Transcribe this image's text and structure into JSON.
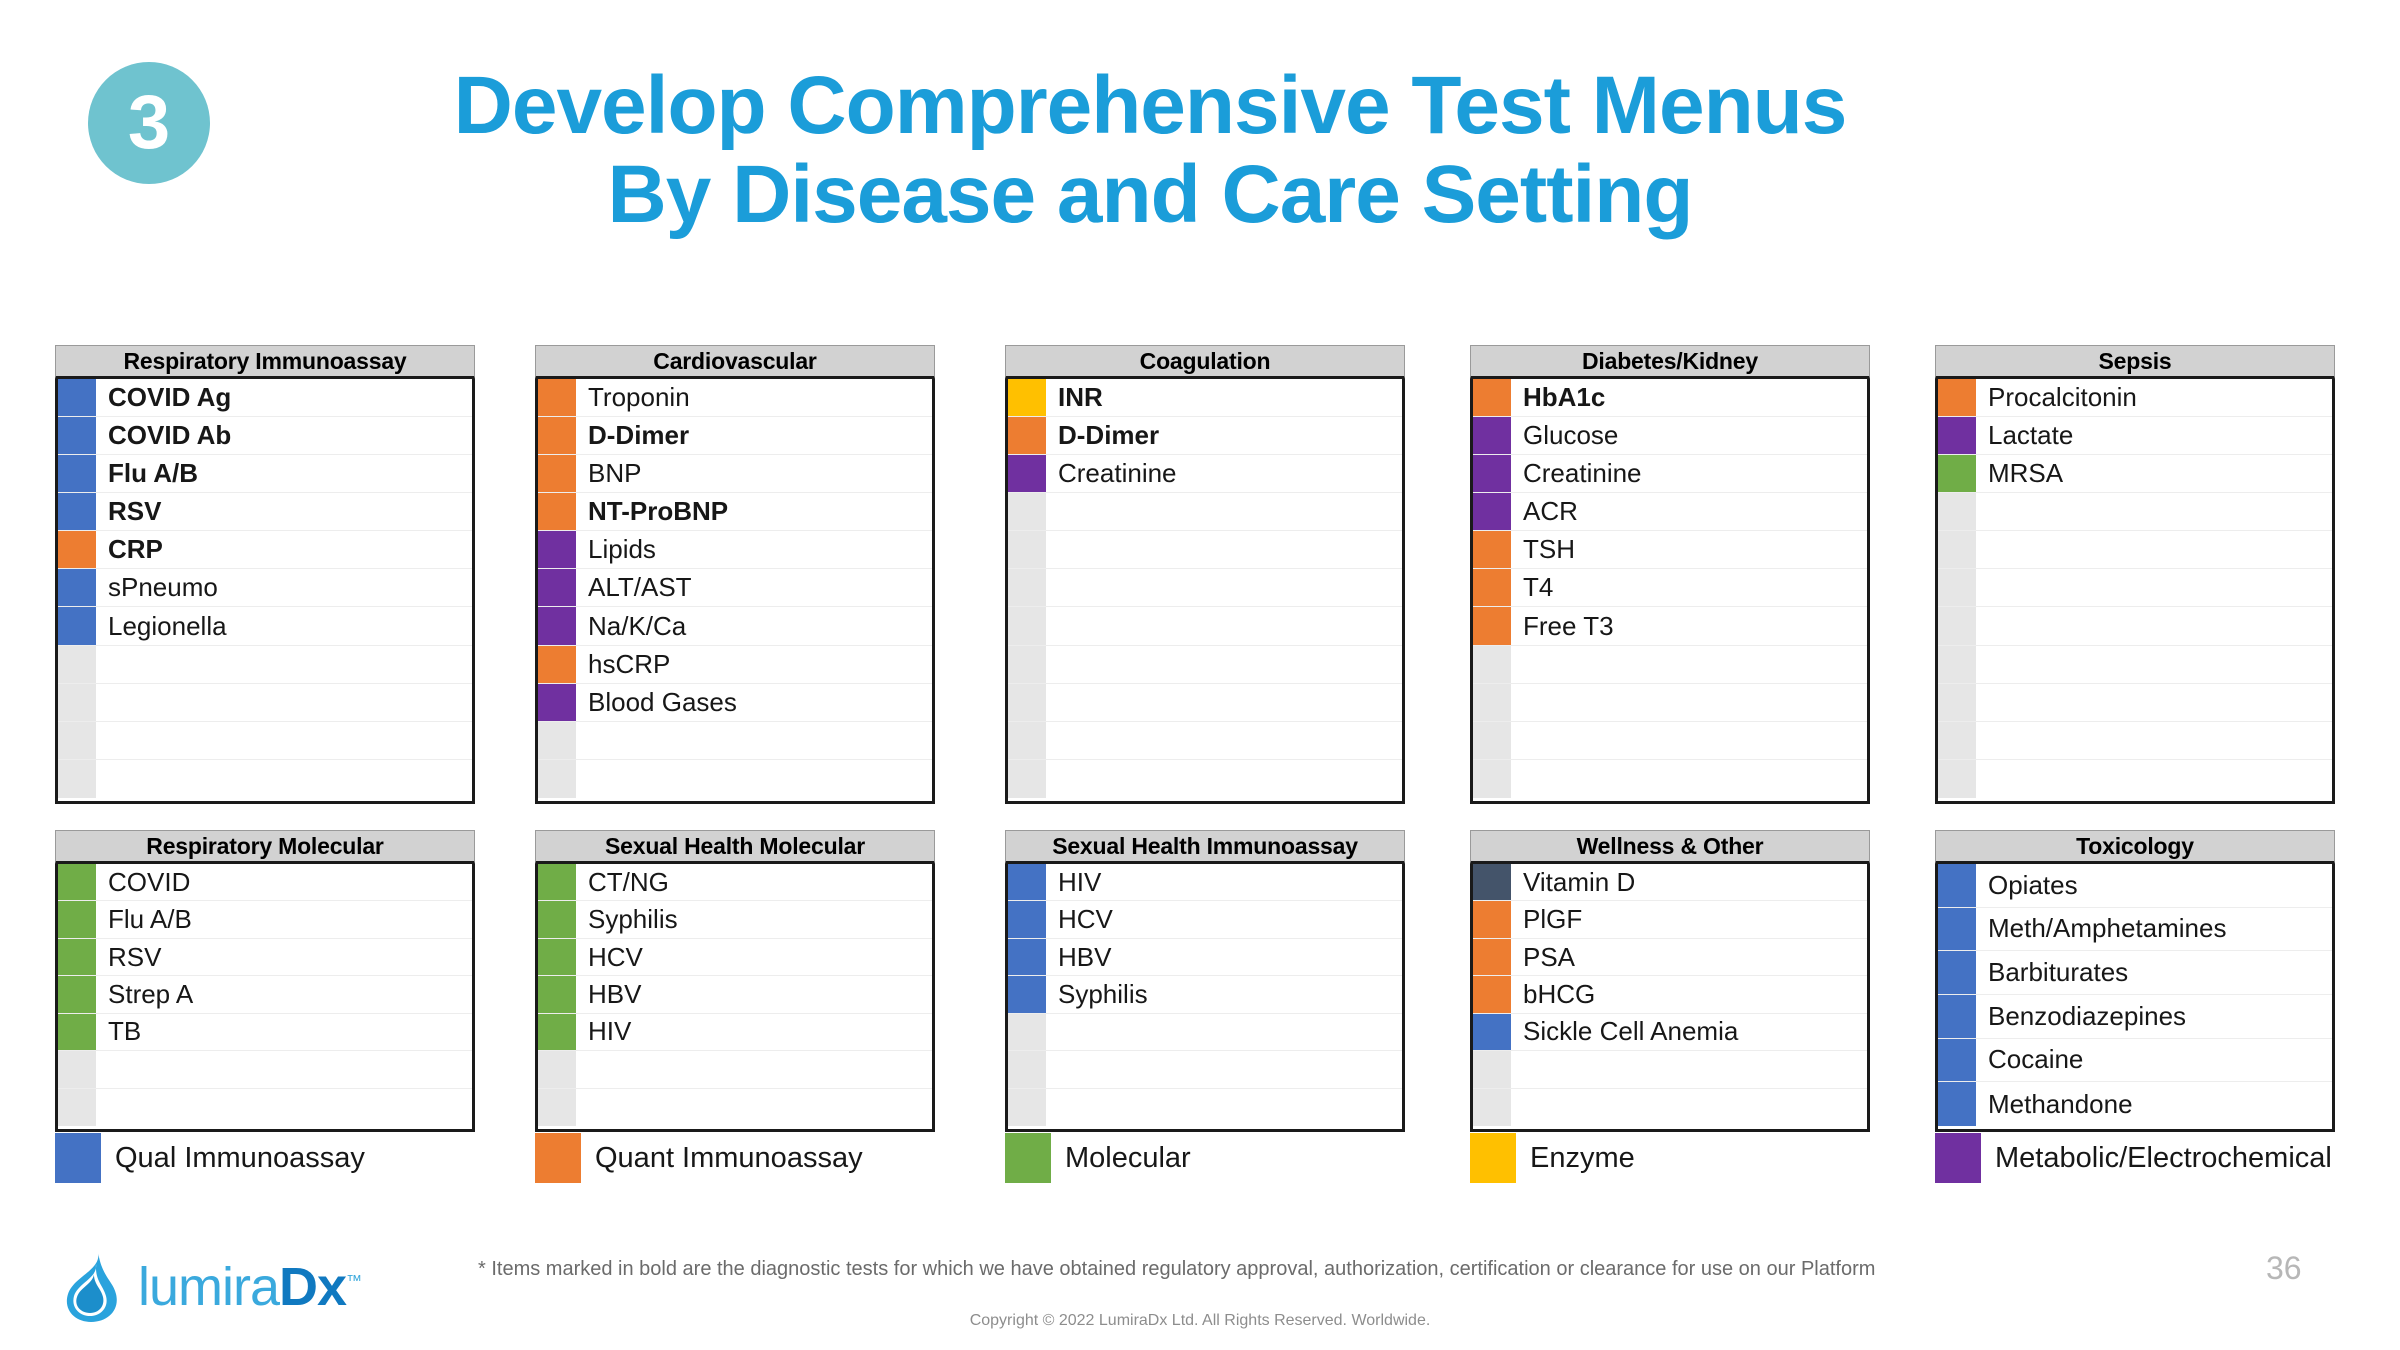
{
  "header": {
    "step_number": "3",
    "title_line1": "Develop Comprehensive Test Menus",
    "title_line2": "By Disease and Care Setting",
    "title_color": "#1b9dd9",
    "badge_color": "#6fc3cf"
  },
  "colors": {
    "qual_immunoassay": "#4472c4",
    "quant_immunoassay": "#ed7d31",
    "molecular": "#70ad47",
    "enzyme": "#ffc000",
    "metabolic_electrochemical": "#7030a0",
    "vitamin_d_dark": "#44546a",
    "empty_row": "#e6e6e6",
    "header_fill": "#d2d2d2"
  },
  "tables": [
    {
      "title": "Respiratory Immunoassay",
      "rows": [
        {
          "label": "COVID Ag",
          "color": "#4472c4",
          "bold": true
        },
        {
          "label": "COVID Ab",
          "color": "#4472c4",
          "bold": true
        },
        {
          "label": "Flu A/B",
          "color": "#4472c4",
          "bold": true
        },
        {
          "label": "RSV",
          "color": "#4472c4",
          "bold": true
        },
        {
          "label": "CRP",
          "color": "#ed7d31",
          "bold": true
        },
        {
          "label": "sPneumo",
          "color": "#4472c4",
          "bold": false
        },
        {
          "label": "Legionella",
          "color": "#4472c4",
          "bold": false
        },
        {
          "label": "",
          "color": "#e6e6e6",
          "bold": false
        },
        {
          "label": "",
          "color": "#e6e6e6",
          "bold": false
        },
        {
          "label": "",
          "color": "#e6e6e6",
          "bold": false
        },
        {
          "label": "",
          "color": "#e6e6e6",
          "bold": false
        }
      ]
    },
    {
      "title": "Cardiovascular",
      "rows": [
        {
          "label": "Troponin",
          "color": "#ed7d31",
          "bold": false
        },
        {
          "label": "D-Dimer",
          "color": "#ed7d31",
          "bold": true
        },
        {
          "label": "BNP",
          "color": "#ed7d31",
          "bold": false
        },
        {
          "label": "NT-ProBNP",
          "color": "#ed7d31",
          "bold": true
        },
        {
          "label": "Lipids",
          "color": "#7030a0",
          "bold": false
        },
        {
          "label": "ALT/AST",
          "color": "#7030a0",
          "bold": false
        },
        {
          "label": "Na/K/Ca",
          "color": "#7030a0",
          "bold": false
        },
        {
          "label": "hsCRP",
          "color": "#ed7d31",
          "bold": false
        },
        {
          "label": "Blood Gases",
          "color": "#7030a0",
          "bold": false
        },
        {
          "label": "",
          "color": "#e6e6e6",
          "bold": false
        },
        {
          "label": "",
          "color": "#e6e6e6",
          "bold": false
        }
      ]
    },
    {
      "title": "Coagulation",
      "rows": [
        {
          "label": "INR",
          "color": "#ffc000",
          "bold": true
        },
        {
          "label": "D-Dimer",
          "color": "#ed7d31",
          "bold": true
        },
        {
          "label": "Creatinine",
          "color": "#7030a0",
          "bold": false
        },
        {
          "label": "",
          "color": "#e6e6e6",
          "bold": false
        },
        {
          "label": "",
          "color": "#e6e6e6",
          "bold": false
        },
        {
          "label": "",
          "color": "#e6e6e6",
          "bold": false
        },
        {
          "label": "",
          "color": "#e6e6e6",
          "bold": false
        },
        {
          "label": "",
          "color": "#e6e6e6",
          "bold": false
        },
        {
          "label": "",
          "color": "#e6e6e6",
          "bold": false
        },
        {
          "label": "",
          "color": "#e6e6e6",
          "bold": false
        },
        {
          "label": "",
          "color": "#e6e6e6",
          "bold": false
        }
      ]
    },
    {
      "title": "Diabetes/Kidney",
      "rows": [
        {
          "label": "HbA1c",
          "color": "#ed7d31",
          "bold": true
        },
        {
          "label": "Glucose",
          "color": "#7030a0",
          "bold": false
        },
        {
          "label": "Creatinine",
          "color": "#7030a0",
          "bold": false
        },
        {
          "label": "ACR",
          "color": "#7030a0",
          "bold": false
        },
        {
          "label": "TSH",
          "color": "#ed7d31",
          "bold": false
        },
        {
          "label": "T4",
          "color": "#ed7d31",
          "bold": false
        },
        {
          "label": "Free T3",
          "color": "#ed7d31",
          "bold": false
        },
        {
          "label": "",
          "color": "#e6e6e6",
          "bold": false
        },
        {
          "label": "",
          "color": "#e6e6e6",
          "bold": false
        },
        {
          "label": "",
          "color": "#e6e6e6",
          "bold": false
        },
        {
          "label": "",
          "color": "#e6e6e6",
          "bold": false
        }
      ]
    },
    {
      "title": "Sepsis",
      "rows": [
        {
          "label": "Procalcitonin",
          "color": "#ed7d31",
          "bold": false
        },
        {
          "label": "Lactate",
          "color": "#7030a0",
          "bold": false
        },
        {
          "label": "MRSA",
          "color": "#70ad47",
          "bold": false
        },
        {
          "label": "",
          "color": "#e6e6e6",
          "bold": false
        },
        {
          "label": "",
          "color": "#e6e6e6",
          "bold": false
        },
        {
          "label": "",
          "color": "#e6e6e6",
          "bold": false
        },
        {
          "label": "",
          "color": "#e6e6e6",
          "bold": false
        },
        {
          "label": "",
          "color": "#e6e6e6",
          "bold": false
        },
        {
          "label": "",
          "color": "#e6e6e6",
          "bold": false
        },
        {
          "label": "",
          "color": "#e6e6e6",
          "bold": false
        },
        {
          "label": "",
          "color": "#e6e6e6",
          "bold": false
        }
      ]
    },
    {
      "title": "Respiratory Molecular",
      "rows": [
        {
          "label": "COVID",
          "color": "#70ad47",
          "bold": false
        },
        {
          "label": "Flu A/B",
          "color": "#70ad47",
          "bold": false
        },
        {
          "label": "RSV",
          "color": "#70ad47",
          "bold": false
        },
        {
          "label": "Strep A",
          "color": "#70ad47",
          "bold": false
        },
        {
          "label": "TB",
          "color": "#70ad47",
          "bold": false
        },
        {
          "label": "",
          "color": "#e6e6e6",
          "bold": false
        },
        {
          "label": "",
          "color": "#e6e6e6",
          "bold": false
        }
      ]
    },
    {
      "title": "Sexual Health Molecular",
      "rows": [
        {
          "label": "CT/NG",
          "color": "#70ad47",
          "bold": false
        },
        {
          "label": "Syphilis",
          "color": "#70ad47",
          "bold": false
        },
        {
          "label": "HCV",
          "color": "#70ad47",
          "bold": false
        },
        {
          "label": "HBV",
          "color": "#70ad47",
          "bold": false
        },
        {
          "label": "HIV",
          "color": "#70ad47",
          "bold": false
        },
        {
          "label": "",
          "color": "#e6e6e6",
          "bold": false
        },
        {
          "label": "",
          "color": "#e6e6e6",
          "bold": false
        }
      ]
    },
    {
      "title": "Sexual Health Immunoassay",
      "rows": [
        {
          "label": "HIV",
          "color": "#4472c4",
          "bold": false
        },
        {
          "label": "HCV",
          "color": "#4472c4",
          "bold": false
        },
        {
          "label": "HBV",
          "color": "#4472c4",
          "bold": false
        },
        {
          "label": "Syphilis",
          "color": "#4472c4",
          "bold": false
        },
        {
          "label": "",
          "color": "#e6e6e6",
          "bold": false
        },
        {
          "label": "",
          "color": "#e6e6e6",
          "bold": false
        },
        {
          "label": "",
          "color": "#e6e6e6",
          "bold": false
        }
      ]
    },
    {
      "title": "Wellness & Other",
      "rows": [
        {
          "label": "Vitamin D",
          "color": "#44546a",
          "bold": false
        },
        {
          "label": "PlGF",
          "color": "#ed7d31",
          "bold": false
        },
        {
          "label": "PSA",
          "color": "#ed7d31",
          "bold": false
        },
        {
          "label": "bHCG",
          "color": "#ed7d31",
          "bold": false
        },
        {
          "label": "Sickle Cell Anemia",
          "color": "#4472c4",
          "bold": false
        },
        {
          "label": "",
          "color": "#e6e6e6",
          "bold": false
        },
        {
          "label": "",
          "color": "#e6e6e6",
          "bold": false
        }
      ]
    },
    {
      "title": "Toxicology",
      "rows": [
        {
          "label": "Opiates",
          "color": "#4472c4",
          "bold": false
        },
        {
          "label": "Meth/Amphetamines",
          "color": "#4472c4",
          "bold": false
        },
        {
          "label": "Barbiturates",
          "color": "#4472c4",
          "bold": false
        },
        {
          "label": "Benzodiazepines",
          "color": "#4472c4",
          "bold": false
        },
        {
          "label": "Cocaine",
          "color": "#4472c4",
          "bold": false
        },
        {
          "label": "Methandone",
          "color": "#4472c4",
          "bold": false
        }
      ]
    }
  ],
  "legend": [
    {
      "label": "Qual Immunoassay",
      "color": "#4472c4"
    },
    {
      "label": "Quant Immunoassay",
      "color": "#ed7d31"
    },
    {
      "label": "Molecular",
      "color": "#70ad47"
    },
    {
      "label": "Enzyme",
      "color": "#ffc000"
    },
    {
      "label": "Metabolic/Electrochemical",
      "color": "#7030a0"
    }
  ],
  "footer": {
    "footnote": "* Items marked in bold are the diagnostic tests for which we have obtained regulatory approval, authorization, certification or clearance for use on our Platform",
    "copyright": "Copyright © 2022 LumiraDx Ltd.  All Rights Reserved.  Worldwide.",
    "page_number": "36",
    "logo_text_light": "lumira",
    "logo_text_bold": "Dx",
    "logo_tm": "™"
  }
}
